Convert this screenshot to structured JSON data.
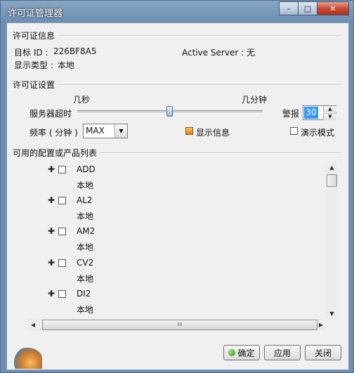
{
  "window": {
    "title": "许可证管理器",
    "minimize": "–",
    "maximize": "□",
    "close": "✕"
  },
  "license_info": {
    "group_title": "许可证信息",
    "target_id_label": "目标 ID :",
    "target_id_value": "226BF8A5",
    "active_server": "Active Server : 无",
    "display_type_label": "显示类型 :",
    "display_type_value": "本地"
  },
  "license_settings": {
    "group_title": "许可证设置",
    "slider_min_label": "几秒",
    "slider_max_label": "几分钟",
    "server_timeout_label": "服务器超时",
    "slider_level": 0.5,
    "alert_label": "警报",
    "alert_value": "30",
    "frequency_label": "频率 ( 分钟 )",
    "frequency_value": "MAX",
    "show_info_label": "显示信息",
    "show_info_checked": true,
    "demo_mode_label": "演示模式",
    "demo_mode_checked": false
  },
  "products": {
    "group_title": "可用的配置或产品列表",
    "items": [
      {
        "name": "ADD",
        "sub": "本地"
      },
      {
        "name": "AL2",
        "sub": "本地"
      },
      {
        "name": "AM2",
        "sub": "本地"
      },
      {
        "name": "CV2",
        "sub": "本地"
      },
      {
        "name": "DI2",
        "sub": "本地"
      }
    ],
    "hscroll_grip": "III"
  },
  "buttons": {
    "ok": "确定",
    "apply": "应用",
    "cancel": "关闭"
  }
}
